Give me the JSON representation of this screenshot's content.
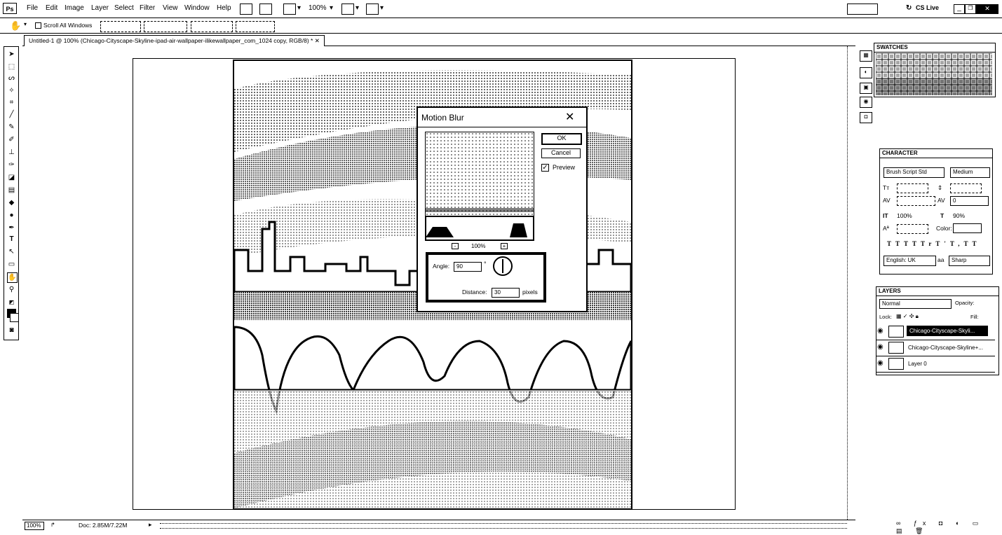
{
  "app": {
    "logo": "Ps",
    "menus": [
      "File",
      "Edit",
      "Image",
      "Layer",
      "Select",
      "Filter",
      "View",
      "Window",
      "Help"
    ],
    "zoom_display": "100%",
    "cs_live": "CS Live"
  },
  "options_bar": {
    "scroll_all_windows": "Scroll All Windows"
  },
  "document": {
    "tab_title": "Untitled-1 @ 100% (Chicago-Cityscape-Skyline-ipad-air-wallpaper-ilikewallpaper_com_1024 copy, RGB/8) *",
    "status_zoom": "100%",
    "doc_size": "Doc: 2.85M/7.22M"
  },
  "motion_blur": {
    "title": "Motion Blur",
    "ok_label": "OK",
    "cancel_label": "Cancel",
    "preview_label": "Preview",
    "preview_checked": true,
    "preview_zoom": "100%",
    "angle_label": "Angle:",
    "angle_value": "90",
    "angle_unit": "°",
    "distance_label": "Distance:",
    "distance_value": "30",
    "distance_unit": "pixels"
  },
  "swatches": {
    "title": "SWATCHES"
  },
  "character": {
    "title": "CHARACTER",
    "font_family": "Brush Script Std",
    "font_style": "Medium",
    "tracking": "0",
    "vertical_scale": "100%",
    "horizontal_scale": "90%",
    "color_label": "Color:",
    "language": "English: UK",
    "antialias": "Sharp",
    "type_buttons": [
      "T",
      "T",
      "TT",
      "Tr",
      "T'",
      "T,",
      "T",
      "T"
    ]
  },
  "layers": {
    "title": "LAYERS",
    "blend_mode": "Normal",
    "opacity_label": "Opacity:",
    "lock_label": "Lock:",
    "fill_label": "Fill:",
    "items": [
      {
        "name": "Chicago-Cityscape-Skyli...",
        "selected": true
      },
      {
        "name": "Chicago-Cityscape-Skyline+...",
        "selected": false
      },
      {
        "name": "Layer 0",
        "selected": false
      }
    ]
  }
}
